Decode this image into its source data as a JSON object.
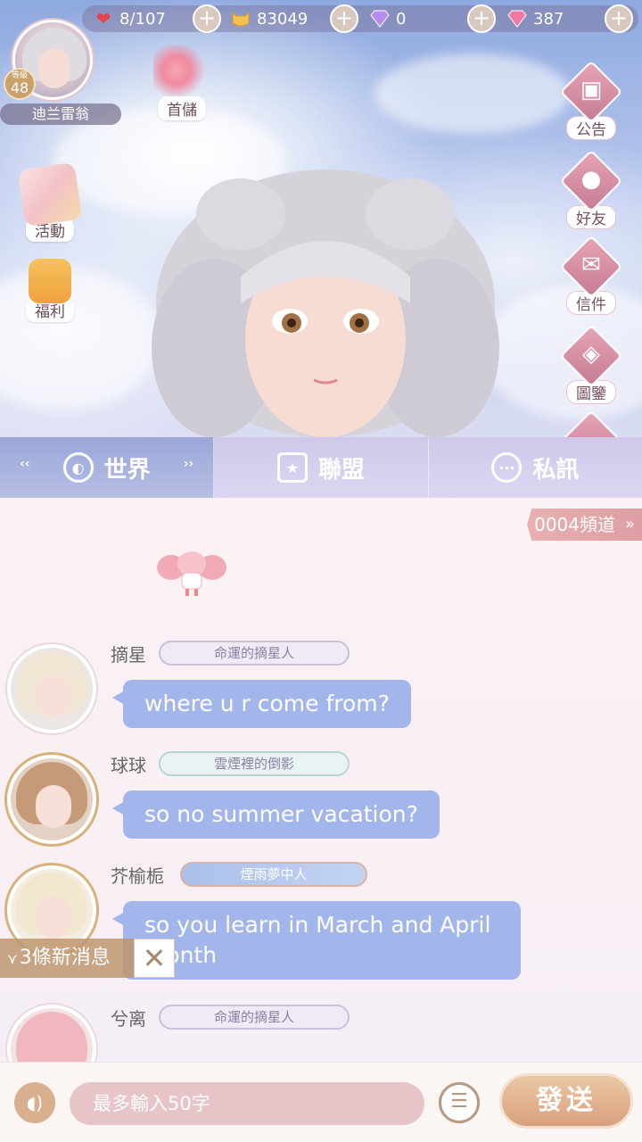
{
  "resources": {
    "stamina": "8/107",
    "coins": "83049",
    "diamonds_blue": "0",
    "diamonds_pink": "387"
  },
  "player": {
    "level_label": "等級",
    "level": "48",
    "name": "迪兰雷翁"
  },
  "left_menu": {
    "first_purchase": "首儲",
    "events": "活動",
    "welfare": "福利"
  },
  "right_menu": {
    "announcement": "公告",
    "friends": "好友",
    "mail": "信件",
    "collection": "圖鑒"
  },
  "tabs": [
    {
      "label": "世界"
    },
    {
      "label": "聯盟"
    },
    {
      "label": "私訊"
    }
  ],
  "channel": "0004頻道",
  "messages": [
    {
      "name": "摘星",
      "title": "命運的摘星人",
      "text": "where u r come from?"
    },
    {
      "name": "球球",
      "title": "雲煙裡的倒影",
      "text": "so no summer vacation?"
    },
    {
      "name": "芥榆栀",
      "title": "煙雨夢中人",
      "text_line1": "so you learn in March and April",
      "text_line2": "month"
    },
    {
      "name": "兮离",
      "title": "命運的摘星人"
    }
  ],
  "new_messages": "3條新消息",
  "input": {
    "placeholder": "最多輸入50字",
    "send_label": "發送"
  },
  "colors": {
    "bubble": "#a3b6ec",
    "tab_bar": "#cfc8ea",
    "send_button": "#d8a07c",
    "channel_tag": "#dd9ea4"
  }
}
